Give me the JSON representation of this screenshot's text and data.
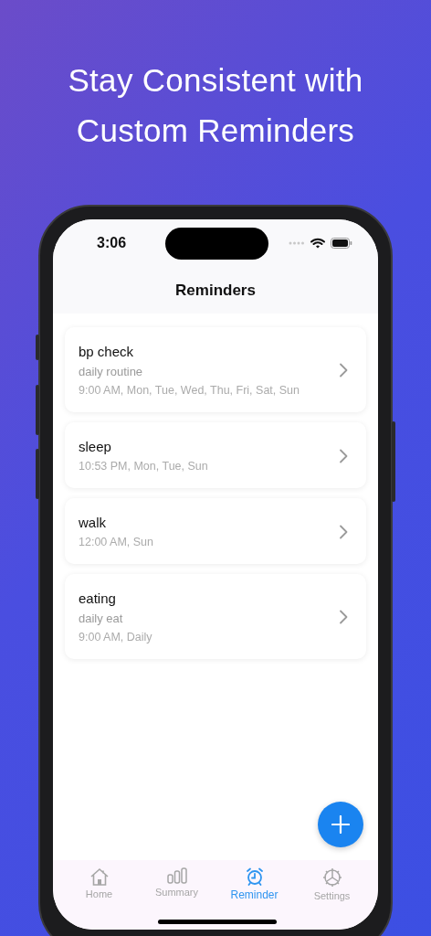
{
  "headline": "Stay Consistent with Custom Reminders",
  "status_bar": {
    "time": "3:06"
  },
  "nav": {
    "title": "Reminders"
  },
  "reminders": [
    {
      "title": "bp check",
      "note": "daily routine",
      "schedule": "9:00 AM, Mon, Tue, Wed, Thu, Fri, Sat, Sun"
    },
    {
      "title": "sleep",
      "schedule": "10:53 PM, Mon, Tue, Sun"
    },
    {
      "title": "walk",
      "schedule": "12:00 AM, Sun"
    },
    {
      "title": "eating",
      "note": "daily eat",
      "schedule": "9:00 AM, Daily"
    }
  ],
  "tabs": [
    {
      "label": "Home",
      "kind": "home",
      "selected": false
    },
    {
      "label": "Summary",
      "kind": "summary",
      "selected": false
    },
    {
      "label": "Reminder",
      "kind": "reminder",
      "selected": true
    },
    {
      "label": "Settings",
      "kind": "settings",
      "selected": false
    }
  ]
}
